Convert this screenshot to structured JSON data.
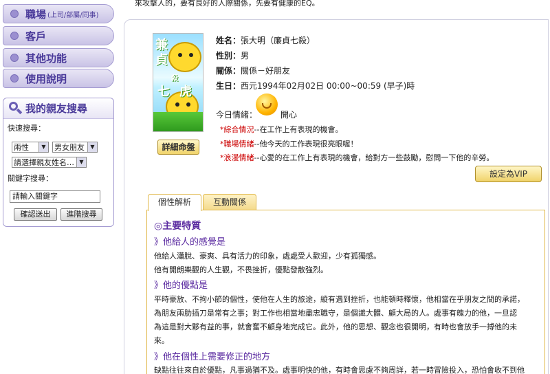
{
  "top_text": "來攻擊人的，要有良好的人際關係，先要有健康的EQ。",
  "nav": [
    {
      "label": "職場",
      "sub": "(上司/部屬/同事)"
    },
    {
      "label": "客戶",
      "sub": ""
    },
    {
      "label": "其他功能",
      "sub": ""
    },
    {
      "label": "使用說明",
      "sub": ""
    }
  ],
  "friend_search": {
    "title": "我的親友搜尋",
    "quick_label": "快速搜尋：",
    "select_gender": "兩性",
    "select_relation": "男女朋友",
    "select_name": "請選擇親友姓名…",
    "keyword_label": "關鍵字搜尋：",
    "keyword_placeholder": "請輸入關鍵字",
    "confirm_button": "確認送出",
    "advanced_button": "進階搜尋"
  },
  "profile": {
    "photo_chars": [
      "兼",
      "貞",
      "七",
      "殺",
      "虎"
    ],
    "destiny_button": "詳細命盤",
    "name_label": "姓名：",
    "name_value": "張大明（廉貞七殺）",
    "gender_label": "性別：",
    "gender_value": "男",
    "relation_label": "關係：",
    "relation_value": "關係－好朋友",
    "birth_label": "生日：",
    "birth_value": "西元1994年02月02日  00:00~00:59 (早子)時",
    "mood_label": "今日情緒：",
    "mood_value": "開心",
    "fortunes": [
      {
        "star": "*",
        "head": "綜合情況",
        "text": "--在工作上有表現的機會。"
      },
      {
        "star": "*",
        "head": "職場情緒",
        "text": "--他今天的工作表現很亮眼喔！"
      },
      {
        "star": "*",
        "head": "浪漫情緒",
        "text": "--心愛的在工作上有表現的機會，給對方一些鼓勵，慰問一下他的辛勞。"
      }
    ],
    "vip_button": "設定為VIP"
  },
  "tabs": [
    {
      "label": "個性解析"
    },
    {
      "label": "互動關係"
    }
  ],
  "content": {
    "section_title": "◎主要特質",
    "sub1": "》他給人的感覺是",
    "sub1_lines": [
      "他給人瀟脫、豪爽、具有活力的印象，處處受人歡迎，少有孤獨感。",
      "他有開朗樂觀的人生觀，不畏挫折，優點發散強烈。"
    ],
    "sub2": "》他的優點是",
    "sub2_lines": [
      "平時豪放、不拘小節的個性，使他在人生的旅途，縱有遇到挫折，也能頓時釋懷，他相當在乎朋友之間的承諾，",
      "為朋友兩肋插刀是常有之事；對工作也相當地盡忠職守，是個識大體、顧大局的人。處事有魄力的他，一旦認",
      "為這是對大夥有益的事，就會奮不顧身地完成它。此外，他的思想、觀念也很開明，有時也會放手一搏他的未",
      "來。"
    ],
    "sub3": "》他在個性上需要修正的地方",
    "sub3_lines": [
      "缺點往往來自於優點，凡事過猶不及。處事明快的他，有時會思慮不夠周詳，若一時冒險投入，恐怕會收不到他"
    ]
  },
  "colors": {
    "accent": "#5a2aa0",
    "nav_bg": "#c9c3e6",
    "tab_border": "#e0b84a",
    "fortune_star": "#cc0000"
  }
}
